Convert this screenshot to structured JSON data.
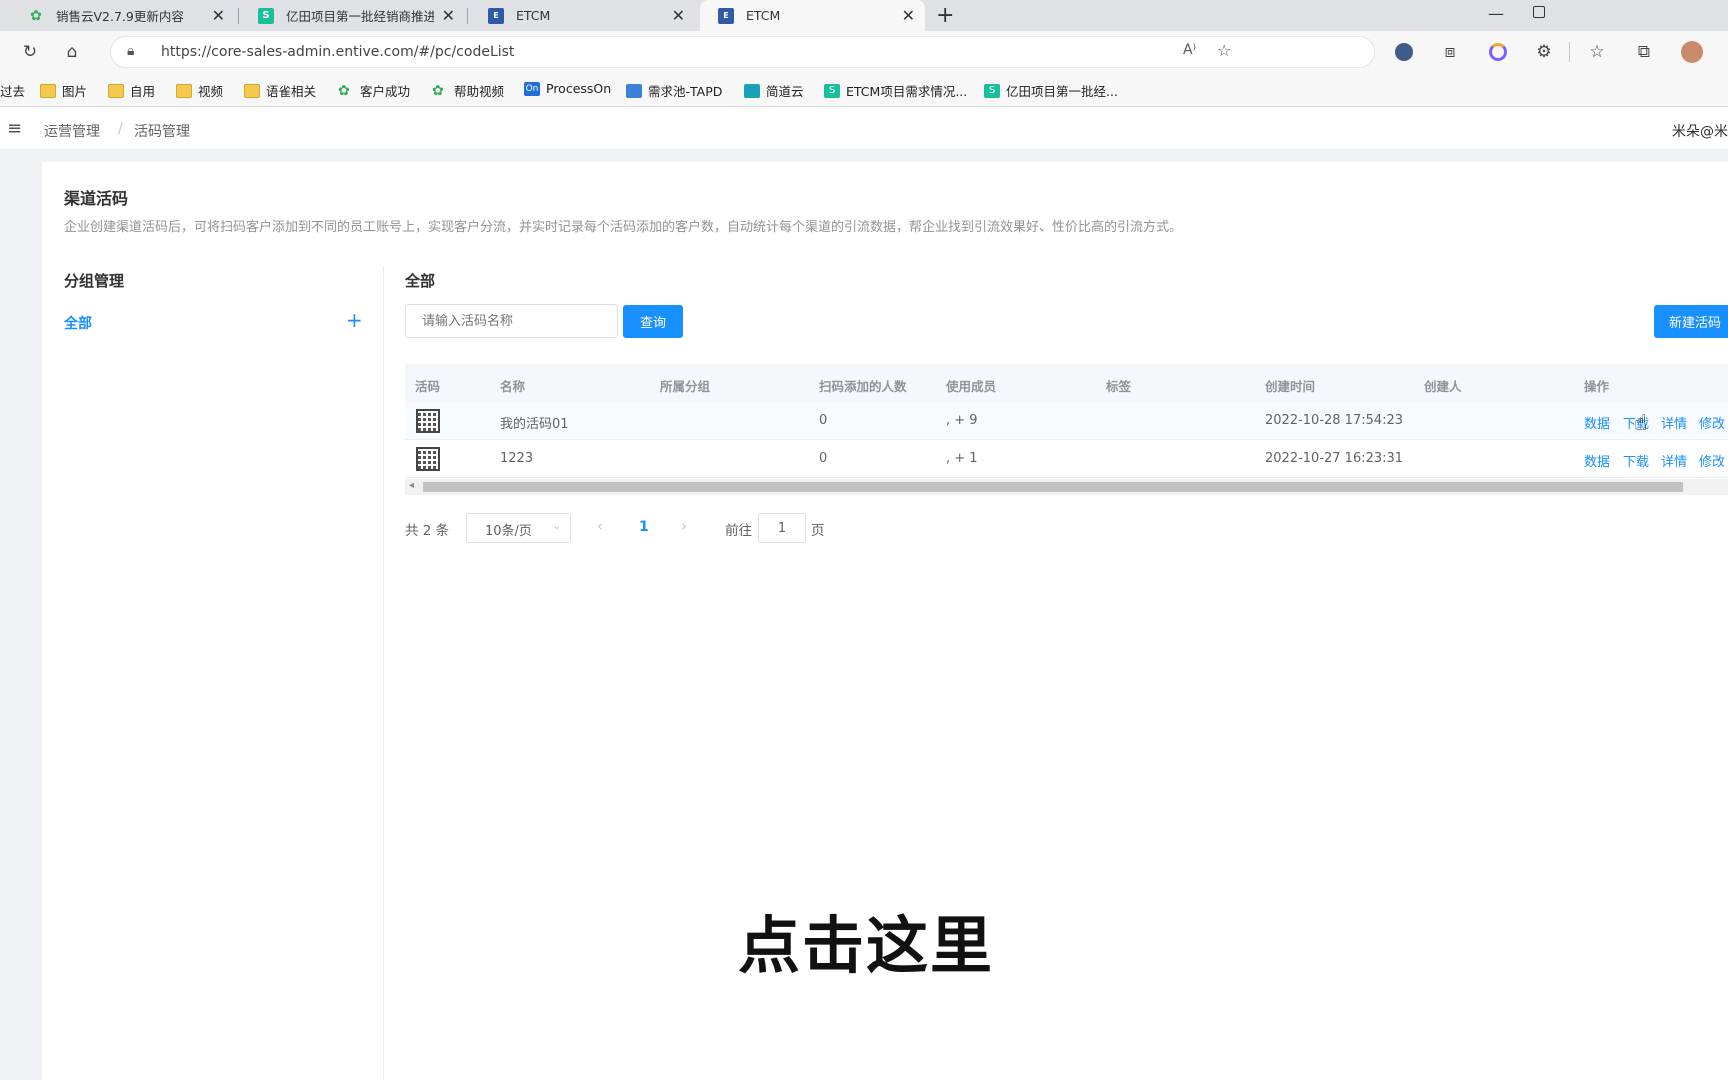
{
  "browser": {
    "tabs": [
      {
        "title": "销售云V2.7.9更新内容",
        "favicon": "leaf-icon"
      },
      {
        "title": "亿田项目第一批经销商推进度",
        "favicon": "s-doc-icon"
      },
      {
        "title": "ETCM",
        "favicon": "etcm-icon"
      },
      {
        "title": "ETCM",
        "favicon": "etcm-icon"
      }
    ],
    "new_tab": "+",
    "url": "https://core-sales-admin.entive.com/#/pc/codeList",
    "bookmarks": [
      {
        "label": "过去",
        "icon": "none"
      },
      {
        "label": "图片",
        "icon": "folder-icon"
      },
      {
        "label": "自用",
        "icon": "folder-icon"
      },
      {
        "label": "视频",
        "icon": "folder-icon"
      },
      {
        "label": "语雀相关",
        "icon": "folder-icon"
      },
      {
        "label": "客户成功",
        "icon": "leaf-icon"
      },
      {
        "label": "帮助视频",
        "icon": "leaf-icon"
      },
      {
        "label": "ProcessOn",
        "icon": "processon-icon",
        "badge": "On"
      },
      {
        "label": "需求池-TAPD",
        "icon": "tapd-icon"
      },
      {
        "label": "简道云",
        "icon": "cloud-icon"
      },
      {
        "label": "ETCM项目需求情况...",
        "icon": "s-doc-icon"
      },
      {
        "label": "亿田项目第一批经...",
        "icon": "s-doc-icon"
      }
    ]
  },
  "header": {
    "breadcrumb": [
      "运营管理",
      "活码管理"
    ],
    "separator": "/",
    "user": "米朵@米"
  },
  "page": {
    "title": "渠道活码",
    "description": "企业创建渠道活码后，可将扫码客户添加到不同的员工账号上，实现客户分流，并实时记录每个活码添加的客户数，自动统计每个渠道的引流数据，帮企业找到引流效果好、性价比高的引流方式。"
  },
  "groups": {
    "title": "分组管理",
    "items": [
      {
        "label": "全部",
        "active": true
      }
    ],
    "add": "+"
  },
  "main": {
    "title": "全部",
    "search_placeholder": "请输入活码名称",
    "query_button": "查询",
    "new_button": "新建活码"
  },
  "table": {
    "headers": [
      "活码",
      "名称",
      "所属分组",
      "扫码添加的人数",
      "使用成员",
      "标签",
      "创建时间",
      "创建人",
      "操作"
    ],
    "rows": [
      {
        "name": "我的活码01",
        "group": "",
        "count": "0",
        "members": ", + 9",
        "tags": "",
        "created": "2022-10-28 17:54:23",
        "creator": ""
      },
      {
        "name": "1223",
        "group": "",
        "count": "0",
        "members": ", + 1",
        "tags": "",
        "created": "2022-10-27 16:23:31",
        "creator": ""
      }
    ],
    "actions": [
      "数据",
      "下载",
      "详情",
      "修改"
    ]
  },
  "pagination": {
    "total": "共 2 条",
    "page_size": "10条/页",
    "current": "1",
    "goto_prefix": "前往",
    "goto_value": "1",
    "goto_suffix": "页"
  },
  "overlay": {
    "caption": "点击这里"
  },
  "colors": {
    "primary": "#1890ff",
    "tab_bar": "#dfe1e5",
    "page_bg": "#f0f2f5"
  }
}
